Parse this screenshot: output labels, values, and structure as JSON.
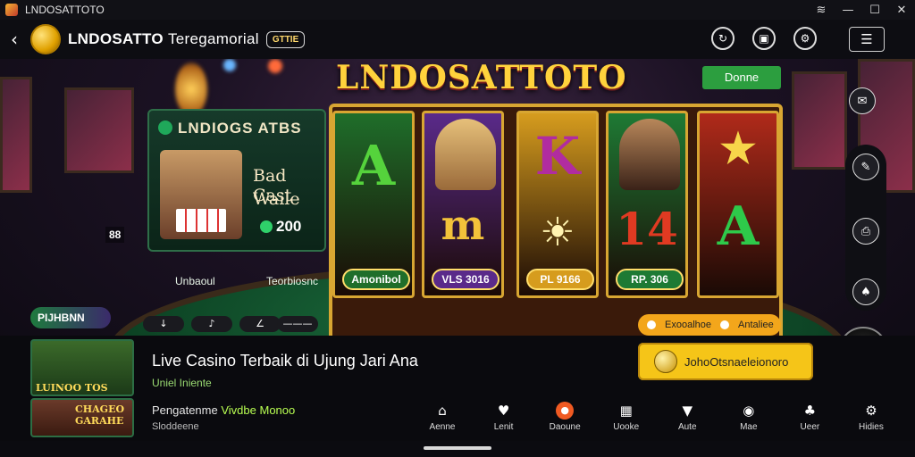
{
  "window": {
    "title": "LNDOSATTOTO",
    "icons": [
      "wifi-icon",
      "minimize-icon",
      "maximize-icon",
      "close-icon"
    ]
  },
  "appbar": {
    "brand": "LNDOSATTO",
    "brand_sub": "Teregamorial",
    "badge": "GTTIE",
    "icons": [
      "refresh-icon",
      "wallet-icon",
      "settings-icon"
    ]
  },
  "slot": {
    "title": "LNDOSATTOTO",
    "donate_label": "Donne",
    "reels": [
      {
        "symbol": "A",
        "button": "Amonibol",
        "color": "#1f6e2a",
        "symbol_color": "#55d33c"
      },
      {
        "symbol": "m",
        "button": "VLS 3016",
        "color": "#5a2a8a",
        "symbol_color": "#f3c23a"
      },
      {
        "symbol": "K",
        "button": "PL 9166",
        "color": "#d69c1e",
        "symbol_color": "#b12ca0"
      },
      {
        "symbol": "14",
        "button": "RP. 306",
        "color": "#1e7a34",
        "symbol_color": "#e03a22"
      },
      {
        "symbol": "A",
        "button": "",
        "color": "#b02a1a",
        "symbol_color": "#2ec94a"
      }
    ]
  },
  "left_panel": {
    "header": "LNDIOGS ATBS",
    "line1": "Bad Cast",
    "line2": "Waile",
    "amount": "200"
  },
  "table": {
    "chip_label": "88",
    "label1": "Unbaoul",
    "label2": "Teorbiosnc",
    "pills": [
      "↓",
      "♪",
      "∠",
      "———"
    ],
    "live_tag": "PIJHBNN"
  },
  "orange_pill": {
    "left": "Exooalhoe",
    "right": "Antaliee"
  },
  "promo": {
    "headline": "Live Casino Terbaik di Ujung Jari Ana",
    "subline": "Uniel Iniente",
    "desc_prefix": "Pengatenme",
    "desc_highlight": "Vivdbe Monoo",
    "desc2": "Sloddeene",
    "cta": "JohoOtsnaeleionoro"
  },
  "thumbs": [
    {
      "label": "LUINOO TOS"
    },
    {
      "label": "CHAGEO GARAHE"
    }
  ],
  "nav": [
    {
      "icon": "⌂",
      "label": "Aenne",
      "name": "home-icon"
    },
    {
      "icon": "♥",
      "label": "Lenit",
      "name": "heart-icon"
    },
    {
      "icon": "●",
      "label": "Daoune",
      "name": "live-icon",
      "active": true
    },
    {
      "icon": "▦",
      "label": "Uooke",
      "name": "grid-icon"
    },
    {
      "icon": "▼",
      "label": "Aute",
      "name": "shield-icon"
    },
    {
      "icon": "◉",
      "label": "Mae",
      "name": "chat-icon"
    },
    {
      "icon": "♣",
      "label": "Ueer",
      "name": "club-icon"
    },
    {
      "icon": "⚙",
      "label": "Hidies",
      "name": "gear-icon"
    }
  ]
}
